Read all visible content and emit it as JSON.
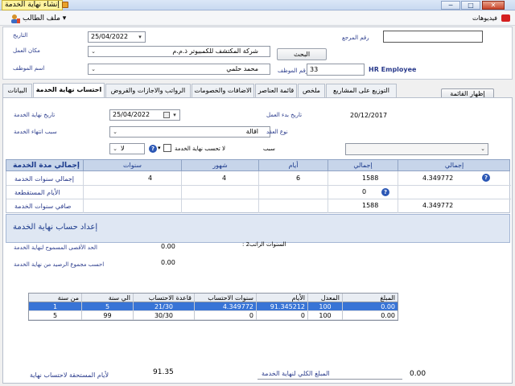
{
  "window": {
    "title": "إنشاء نهاية الخدمة",
    "minimize_glyph": "─",
    "maximize_glyph": "□",
    "close_glyph": "✕"
  },
  "menubar": {
    "user_menu": "ملف الطالب",
    "videos": "فيديوهات"
  },
  "top": {
    "date_label": "التاريخ",
    "date_value": "25/04/2022",
    "workplace_label": "مكان العمل",
    "workplace_value": "شركة المكتشف للكمبيوتر ذ.م.م",
    "employee_name_label": "اسم الموظف",
    "employee_name_value": "محمد حلمي",
    "reference_label": "رقم المرجع",
    "reference_value": "",
    "search_button": "البحث",
    "employee_no_label": "رقم الموظف",
    "employee_no_value": "33",
    "module_title": "HR Employee"
  },
  "tabs": [
    "التوزيع على المشاريع",
    "ملخص",
    "قائمة العناصر",
    "الاضافات والخصومات",
    "الرواتب والاجازات والقروض",
    "احتساب نهاية الخدمة",
    "البيانات"
  ],
  "show_list_button": "إظهار القائمة",
  "form": {
    "end_date_label": "تاريخ نهاية الخدمة",
    "end_date_value": "25/04/2022",
    "end_reason_label": "سبب انتهاء الخدمة",
    "end_reason_value": "اقالة",
    "start_date_label": "تاريخ بدء العمل",
    "start_date_value": "20/12/2017",
    "contract_type_label": "نوع العقد",
    "reason_label": "سبب",
    "no_calc_label": "لا تحسب نهاية الخدمة",
    "no_value": "لا"
  },
  "duration_grid": {
    "header_title": "إجمالي مدة الخدمة",
    "columns": [
      "سنوات",
      "شهور",
      "أيام",
      "إجمالي",
      "إجمالي"
    ],
    "rows": [
      {
        "label": "إجمالي سنوات الخدمة",
        "years": "4",
        "months": "4",
        "days": "6",
        "total": "1588",
        "total2": "4.349772"
      },
      {
        "label": "الأيام المستقطعة",
        "years": "",
        "months": "",
        "days": "",
        "total": "0",
        "total2": ""
      },
      {
        "label": "صافي سنوات الخدمة",
        "years": "",
        "months": "",
        "days": "",
        "total": "1588",
        "total2": "4.349772"
      }
    ]
  },
  "settings": {
    "title": "إعداد حساب نهاية الخدمة",
    "salary_hint": ": 2السنوات  الراتب",
    "max_allowed_label": "الحد الأقصى المسموح لنهاية الخدمة",
    "max_allowed_value": "0.00",
    "balance_label": "احسب مجموع الرصيد من نهاية الخدمة",
    "balance_value": "0.00"
  },
  "calc_table": {
    "headers": [
      "من سنة",
      "الي سنة",
      "قاعدة الاحتساب",
      "سنوات الاحتساب",
      "الأيام",
      "المعدل",
      "المبلغ"
    ],
    "rows": [
      [
        "1",
        "5",
        "21/30",
        "4.349772",
        "91.345212",
        "100",
        "0.00"
      ],
      [
        "5",
        "99",
        "30/30",
        "0",
        "0",
        "100",
        "0.00"
      ]
    ]
  },
  "footer": {
    "days_label": "لأيام المستحقة لاحتساب نهاية",
    "days_value": "91.35",
    "total_label": "المبلغ الكلي لنهاية الخدمة",
    "total_value": "0.00"
  }
}
